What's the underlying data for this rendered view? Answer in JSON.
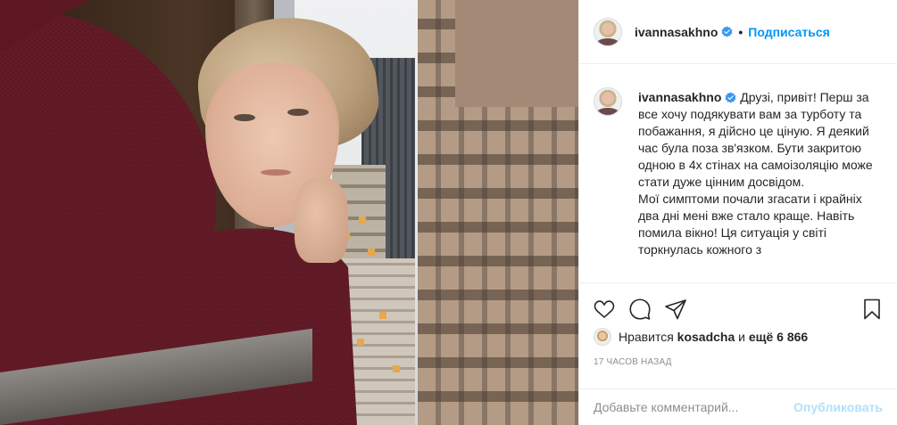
{
  "header": {
    "username": "ivannasakhno",
    "separator": "•",
    "follow_label": "Подписаться"
  },
  "caption": {
    "username": "ivannasakhno",
    "text": "Друзі, привіт! Перш за все хочу подякувати вам за турботу та побажання, я дійсно це ціную. Я деякий час була поза зв'язком. Бути закритою одною в 4х стінах на самоізоляцію може стати дуже цінним досвідом.\nМої симптоми почали згасати і крайніх два дні мені вже стало краще. Навіть помила вікно! Ця ситуація у світі торкнулась кожного з"
  },
  "likes": {
    "prefix": "Нравится",
    "user": "kosadcha",
    "conjunction": "и",
    "more": "ещё 6 866"
  },
  "timestamp": "17 часов назад",
  "comment": {
    "placeholder": "Добавьте комментарий...",
    "post_label": "Опубликовать"
  },
  "icons": {
    "like": "heart-icon",
    "comment": "comment-icon",
    "share": "share-icon",
    "save": "bookmark-icon",
    "verified": "verified-badge-icon"
  },
  "colors": {
    "link_blue": "#0095f6",
    "verified_blue": "#3897f0",
    "post_disabled": "#b2dffc",
    "muted": "#8e8e8e"
  }
}
